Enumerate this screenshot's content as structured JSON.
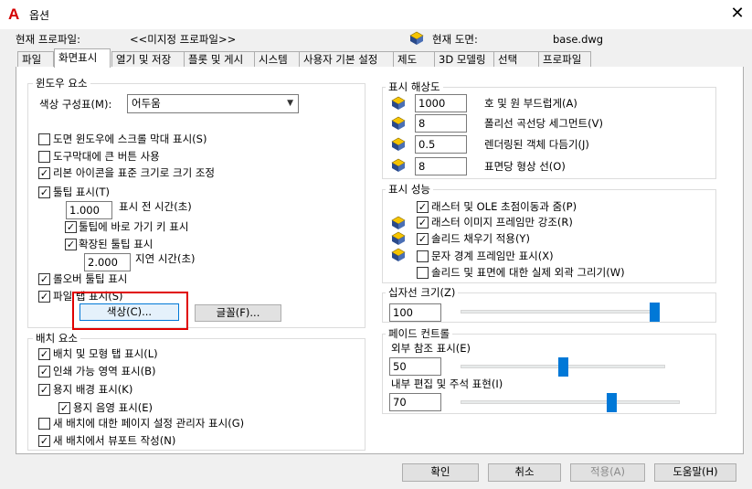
{
  "window": {
    "title": "옵션",
    "close_label": "✕"
  },
  "header": {
    "profile_label": "현재 프로파일:",
    "profile_value": "<<미지정 프로파일>>",
    "drawing_label": "현재 도면:",
    "drawing_value": "base.dwg"
  },
  "tabs": [
    {
      "label": "파일"
    },
    {
      "label": "화면표시",
      "active": true
    },
    {
      "label": "열기 및 저장"
    },
    {
      "label": "플롯 및 게시"
    },
    {
      "label": "시스템"
    },
    {
      "label": "사용자 기본 설정"
    },
    {
      "label": "제도"
    },
    {
      "label": "3D 모델링"
    },
    {
      "label": "선택"
    },
    {
      "label": "프로파일"
    }
  ],
  "window_elements": {
    "title": "윈도우 요소",
    "color_scheme_label": "색상 구성표(M):",
    "color_scheme_value": "어두움",
    "scrollbars": {
      "label": "도면 윈도우에 스크롤 막대 표시(S)",
      "checked": false
    },
    "big_buttons": {
      "label": "도구막대에 큰 버튼 사용",
      "checked": false
    },
    "resize_ribbon": {
      "label": "리본 아이콘을 표준 크기로 크기 조정",
      "checked": true
    },
    "tooltips": {
      "label": "툴팁 표시(T)",
      "checked": true
    },
    "tooltip_delay_value": "1.000",
    "tooltip_delay_label": "표시 전 시간(초)",
    "shortcut_keys": {
      "label": "툴팁에 바로 가기 키 표시",
      "checked": true
    },
    "extended_tooltips": {
      "label": "확장된 툴팁 표시",
      "checked": true
    },
    "delay_value": "2.000",
    "delay_label": "지연 시간(초)",
    "rollover": {
      "label": "롤오버 툴팁 표시",
      "checked": true
    },
    "file_tabs": {
      "label": "파일 탭 표시(S)",
      "checked": true
    },
    "colors_button": "색상(C)...",
    "fonts_button": "글꼴(F)..."
  },
  "layout_elements": {
    "title": "배치 요소",
    "layout_tabs": {
      "label": "배치 및 모형 탭 표시(L)",
      "checked": true
    },
    "printable_area": {
      "label": "인쇄 가능 영역 표시(B)",
      "checked": true
    },
    "paper_background": {
      "label": "용지 배경 표시(K)",
      "checked": true
    },
    "paper_shadow": {
      "label": "용지 음영 표시(E)",
      "checked": true
    },
    "page_setup": {
      "label": "새 배치에 대한 페이지 설정 관리자 표시(G)",
      "checked": false
    },
    "viewport": {
      "label": "새 배치에서 뷰포트 작성(N)",
      "checked": true
    }
  },
  "resolution": {
    "title": "표시 해상도",
    "rows": [
      {
        "value": "1000",
        "label": "호 및 원 부드럽게(A)"
      },
      {
        "value": "8",
        "label": "폴리선 곡선당 세그먼트(V)"
      },
      {
        "value": "0.5",
        "label": "렌더링된 객체 다듬기(J)"
      },
      {
        "value": "8",
        "label": "표면당 형상 선(O)"
      }
    ]
  },
  "performance": {
    "title": "표시 성능",
    "items": [
      {
        "label": "래스터 및 OLE 초점이동과 줌(P)",
        "checked": true
      },
      {
        "label": "래스터 이미지 프레임만 강조(R)",
        "checked": true
      },
      {
        "label": "솔리드 채우기 적용(Y)",
        "checked": true
      },
      {
        "label": "문자 경계 프레임만 표시(X)",
        "checked": false
      },
      {
        "label": "솔리드 및 표면에 대한 실제 외곽 그리기(W)",
        "checked": false
      }
    ]
  },
  "crosshair": {
    "title": "십자선 크기(Z)",
    "value": "100",
    "slider": 1.0
  },
  "fade": {
    "title": "페이드 컨트롤",
    "xref_label": "외부 참조 표시(E)",
    "xref_value": "50",
    "xref_slider": 0.5,
    "inplace_label": "내부 편집 및 주석 표현(I)",
    "inplace_value": "70",
    "inplace_slider": 0.7
  },
  "buttons": {
    "ok": "확인",
    "cancel": "취소",
    "apply": "적용(A)",
    "help": "도움말(H)"
  },
  "check_glyph": "✓"
}
